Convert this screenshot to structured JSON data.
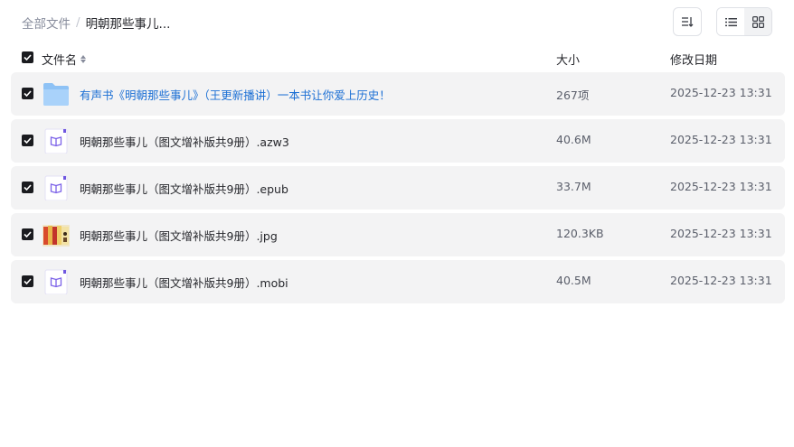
{
  "breadcrumb": {
    "root": "全部文件",
    "separator": "/",
    "current": "明朝那些事儿..."
  },
  "toolbar": {
    "sort_icon": "sort-list-icon",
    "view_list_icon": "list-view-icon",
    "view_grid_icon": "grid-view-icon"
  },
  "columns": {
    "name": "文件名",
    "size": "大小",
    "date": "修改日期"
  },
  "files": [
    {
      "name": "有声书《明朝那些事儿》（王更新播讲）一本书让你爱上历史！",
      "size": "267项",
      "date": "2025-12-23 13:31",
      "type": "folder",
      "icon": "folder-icon",
      "checked": true
    },
    {
      "name": "明朝那些事儿（图文增补版共9册）.azw3",
      "size": "40.6M",
      "date": "2025-12-23 13:31",
      "type": "ebook",
      "icon": "ebook-icon",
      "checked": true
    },
    {
      "name": "明朝那些事儿（图文增补版共9册）.epub",
      "size": "33.7M",
      "date": "2025-12-23 13:31",
      "type": "ebook",
      "icon": "ebook-icon",
      "checked": true
    },
    {
      "name": "明朝那些事儿（图文增补版共9册）.jpg",
      "size": "120.3KB",
      "date": "2025-12-23 13:31",
      "type": "image",
      "icon": "image-thumbnail-icon",
      "checked": true
    },
    {
      "name": "明朝那些事儿（图文增补版共9册）.mobi",
      "size": "40.5M",
      "date": "2025-12-23 13:31",
      "type": "ebook",
      "icon": "ebook-icon",
      "checked": true
    }
  ],
  "colors": {
    "checkbox": "#1a1b1f",
    "folder_link": "#1b6fd4",
    "row_bg": "#f3f3f4",
    "ebook_icon": "#7b61e8"
  }
}
